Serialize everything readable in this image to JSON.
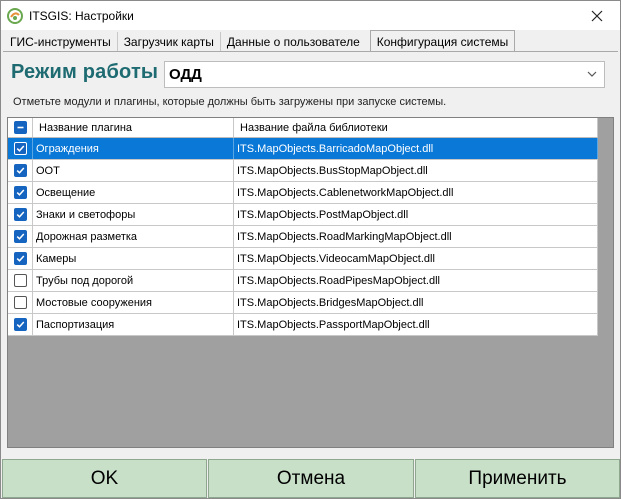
{
  "window": {
    "title": "ITSGIS: Настройки"
  },
  "tabs": [
    {
      "label": "ГИС-инструменты",
      "active": false
    },
    {
      "label": "Загрузчик карты",
      "active": false
    },
    {
      "label": "Данные о пользователе",
      "active": false
    },
    {
      "label": "Конфигурация системы",
      "active": true
    }
  ],
  "mode": {
    "label": "Режим работы",
    "value": "ОДД"
  },
  "hint": "Отметьте модули и плагины, которые должны быть загружены при запуске системы.",
  "grid": {
    "columns": [
      "Название плагина",
      "Название файла библиотеки"
    ],
    "header_check": "mixed",
    "rows": [
      {
        "checked": true,
        "name": "Ограждения",
        "library": "ITS.MapObjects.BarricadoMapObject.dll",
        "selected": true
      },
      {
        "checked": true,
        "name": "ООТ",
        "library": "ITS.MapObjects.BusStopMapObject.dll",
        "selected": false
      },
      {
        "checked": true,
        "name": "Освещение",
        "library": "ITS.MapObjects.CablenetworkMapObject.dll",
        "selected": false
      },
      {
        "checked": true,
        "name": "Знаки и светофоры",
        "library": "ITS.MapObjects.PostMapObject.dll",
        "selected": false
      },
      {
        "checked": true,
        "name": "Дорожная разметка",
        "library": "ITS.MapObjects.RoadMarkingMapObject.dll",
        "selected": false
      },
      {
        "checked": true,
        "name": "Камеры",
        "library": "ITS.MapObjects.VideocamMapObject.dll",
        "selected": false
      },
      {
        "checked": false,
        "name": "Трубы под дорогой",
        "library": "ITS.MapObjects.RoadPipesMapObject.dll",
        "selected": false
      },
      {
        "checked": false,
        "name": "Мостовые сооружения",
        "library": "ITS.MapObjects.BridgesMapObject.dll",
        "selected": false
      },
      {
        "checked": true,
        "name": "Паспортизация",
        "library": "ITS.MapObjects.PassportMapObject.dll",
        "selected": false
      }
    ]
  },
  "buttons": {
    "ok": "OK",
    "cancel": "Отмена",
    "apply": "Применить"
  },
  "icons": {
    "app": "itsgis-logo-icon",
    "close": "close-icon",
    "dropdown": "chevron-down-icon"
  },
  "colors": {
    "accent": "#1e6b72",
    "selection": "#0a78d7",
    "checkbox": "#1565c0",
    "button_bg": "#c8dfc8"
  }
}
